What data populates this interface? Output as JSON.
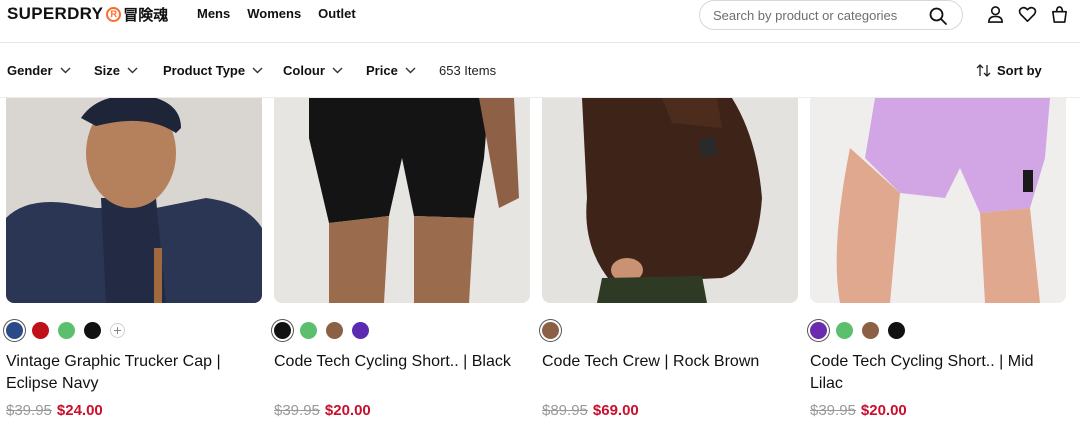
{
  "brand": {
    "name": "SUPERDRY",
    "mark": "R",
    "cjk": "冒険魂"
  },
  "nav": [
    "Mens",
    "Womens",
    "Outlet"
  ],
  "search": {
    "placeholder": "Search by product or categories"
  },
  "header_icons": [
    "search-icon",
    "account-icon",
    "heart-icon",
    "bag-icon"
  ],
  "filters": [
    "Gender",
    "Size",
    "Product Type",
    "Colour",
    "Price"
  ],
  "item_count": "653 Items",
  "sort_label": "Sort by",
  "colors": {
    "sale": "#c8102e",
    "old_price": "#9a9a9a",
    "logo_accent": "#ff6a2b"
  },
  "products": [
    {
      "title": "Vintage Graphic Trucker Cap | Eclipse Navy",
      "old_price": "$39.95",
      "new_price": "$24.00",
      "swatches": [
        "#2c4a8a",
        "#c0101a",
        "#5cbf6e",
        "#111111"
      ],
      "more_swatches": "+"
    },
    {
      "title": "Code Tech Cycling Short.. | Black",
      "old_price": "$39.95",
      "new_price": "$20.00",
      "swatches": [
        "#111111",
        "#5cbf6e",
        "#8b6146",
        "#5a2bb0"
      ]
    },
    {
      "title": "Code Tech Crew | Rock Brown",
      "old_price": "$89.95",
      "new_price": "$69.00",
      "swatches": [
        "#8b6146"
      ]
    },
    {
      "title": "Code Tech Cycling Short.. | Mid Lilac",
      "old_price": "$39.95",
      "new_price": "$20.00",
      "swatches": [
        "#6b2bb0",
        "#5cbf6e",
        "#8b6146",
        "#111111"
      ]
    }
  ]
}
